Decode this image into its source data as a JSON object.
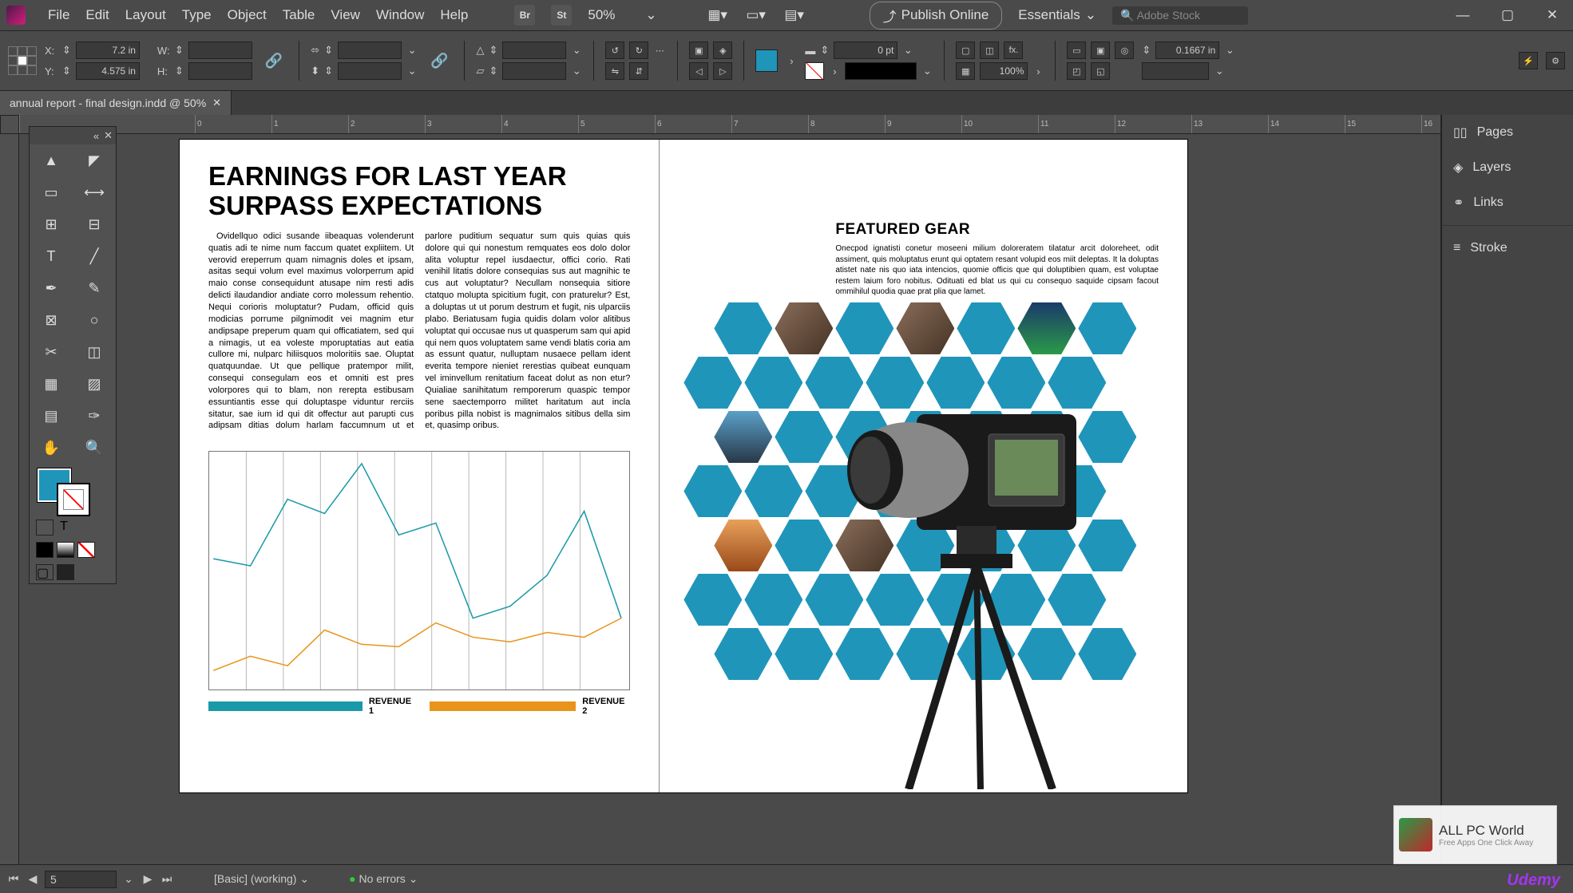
{
  "menu": {
    "items": [
      "File",
      "Edit",
      "Layout",
      "Type",
      "Object",
      "Table",
      "View",
      "Window",
      "Help"
    ]
  },
  "zoom": "50%",
  "publish": "Publish Online",
  "workspace_preset": "Essentials",
  "search_placeholder": "Adobe Stock",
  "document_tab": "annual report - final design.indd @ 50%",
  "control": {
    "x": "7.2 in",
    "y": "4.575 in",
    "w": "",
    "h": "",
    "stroke": "0 pt",
    "leading": "0.1667 in",
    "opacity": "100%"
  },
  "ruler_marks": [
    "0",
    "1",
    "2",
    "3",
    "4",
    "5",
    "6",
    "7",
    "8",
    "9",
    "10",
    "11",
    "12",
    "13",
    "14",
    "15",
    "16"
  ],
  "page_left": {
    "title": "EARNINGS FOR LAST YEAR SURPASS EXPECTATIONS",
    "body": "Ovidellquo odici susande iibeaquas volenderunt quatis adi te nime num faccum quatet expliitem. Ut verovid ereperrum quam nimagnis doles et ipsam, asitas sequi volum evel maximus volorperrum apid maio conse consequidunt atusape nim resti adis delicti ilaudandior andiate corro molessum rehentio. Nequi corioris moluptatur? Pudam, officid quis modicias porrume pilgnimodit vei magnim etur andipsape preperum quam qui officatiatem, sed qui a nimagis, ut ea voleste mporuptatias aut eatia cullore mi, nulparc hiliisquos moloritiis sae. Oluptat quatquundae. Ut que pellique pratempor milit, consequi consegulam eos et omniti est pres volorpores qui to blam, non rerepta estibusam essuntiantis esse qui doluptaspe viduntur rerciis sitatur, sae ium id qui dit offectur aut parupti cus adipsam ditias dolum harlam faccumnum ut et parlore puditium sequatur sum quis quias quis dolore qui qui nonestum remquates eos dolo dolor alita voluptur repel iusdaectur, offici corio. Rati venihil litatis dolore consequias sus aut magnihic te cus aut voluptatur? Necullam nonsequia sitiore ctatquo molupta spicitium fugit, con praturelur? Est, a doluptas ut ut porum destrum et fugit, nis ulparciis plabo. Beriatusam fugia quidis dolam volor alitibus voluptat qui occusae nus ut quasperum sam qui apid qui nem quos voluptatem same vendi blatis coria am as essunt quatur, nulluptam nusaece pellam ident everita tempore nieniet rerestias quibeat eunquam vel iminvellum renitatium faceat dolut as non etur? Quialiae sanihitatum remporerum quaspic tempor sene saectemporro militet haritatum aut incla poribus pilla nobist is magnimalos sitibus della sim et, quasimp oribus.",
    "legend1": "REVENUE 1",
    "legend2": "REVENUE 2"
  },
  "page_right": {
    "title": "FEATURED GEAR",
    "body": "Onecpod ignatisti conetur moseeni milium doloreratem tilatatur arcit doloreheet, odit assiment, quis moluptatus erunt qui optatem resant volupid eos miit deleptas. It la doluptas atistet nate nis quo iata intencios, quomie officis que qui doluptibien quam, est voluptae restem laium foro nobitus. Odituati ed blat us qui cu consequo saquide cipsam facout ommihilul quodia quae prat plia que lamet."
  },
  "chart_data": {
    "type": "line",
    "x": [
      0,
      1,
      2,
      3,
      4,
      5,
      6,
      7,
      8,
      9,
      10,
      11
    ],
    "series": [
      {
        "name": "REVENUE 1",
        "color": "#1a9aa8",
        "values": [
          55,
          52,
          80,
          74,
          95,
          65,
          70,
          30,
          35,
          48,
          75,
          30
        ]
      },
      {
        "name": "REVENUE 2",
        "color": "#e8941a",
        "values": [
          8,
          14,
          10,
          25,
          19,
          18,
          28,
          22,
          20,
          24,
          22,
          30
        ]
      }
    ],
    "ylim": [
      0,
      100
    ]
  },
  "right_panels": [
    "Pages",
    "Layers",
    "Links",
    "Stroke"
  ],
  "status": {
    "page": "5",
    "preset": "[Basic] (working)",
    "errors": "No errors"
  },
  "watermark": {
    "title": "ALL PC World",
    "sub": "Free Apps One Click Away"
  },
  "udemy": "Udemy"
}
